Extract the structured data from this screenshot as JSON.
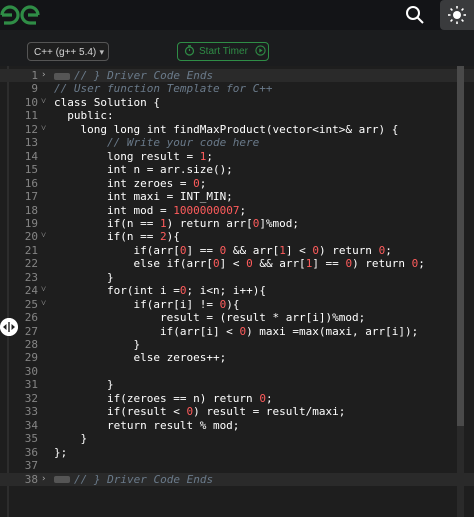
{
  "header": {
    "logo_alt": "GfG",
    "icons": {
      "search": "search-icon",
      "theme": "sun-icon"
    }
  },
  "toolbar": {
    "language": "C++ (g++ 5.4)",
    "timer_label": "Start Timer"
  },
  "editor": {
    "lines": [
      {
        "n": "1",
        "fold": "›",
        "text": "// } Driver Code Ends"
      },
      {
        "n": "9",
        "fold": "",
        "text": "// User function Template for C++"
      },
      {
        "n": "10",
        "fold": "˅",
        "text": "class Solution {"
      },
      {
        "n": "11",
        "fold": "",
        "text": "  public:"
      },
      {
        "n": "12",
        "fold": "˅",
        "text": "    long long int findMaxProduct(vector<int>& arr) {"
      },
      {
        "n": "13",
        "fold": "",
        "text": "        // Write your code here"
      },
      {
        "n": "14",
        "fold": "",
        "text": "        long result = 1;"
      },
      {
        "n": "15",
        "fold": "",
        "text": "        int n = arr.size();"
      },
      {
        "n": "16",
        "fold": "",
        "text": "        int zeroes = 0;"
      },
      {
        "n": "17",
        "fold": "",
        "text": "        int maxi = INT_MIN;"
      },
      {
        "n": "18",
        "fold": "",
        "text": "        int mod = 1000000007;"
      },
      {
        "n": "19",
        "fold": "",
        "text": "        if(n == 1) return arr[0]%mod;"
      },
      {
        "n": "20",
        "fold": "˅",
        "text": "        if(n == 2){"
      },
      {
        "n": "21",
        "fold": "",
        "text": "            if(arr[0] == 0 && arr[1] < 0) return 0;"
      },
      {
        "n": "22",
        "fold": "",
        "text": "            else if(arr[0] < 0 && arr[1] == 0) return 0;"
      },
      {
        "n": "23",
        "fold": "",
        "text": "        }"
      },
      {
        "n": "24",
        "fold": "˅",
        "text": "        for(int i =0; i<n; i++){"
      },
      {
        "n": "25",
        "fold": "˅",
        "text": "            if(arr[i] != 0){"
      },
      {
        "n": "26",
        "fold": "",
        "text": "                result = (result * arr[i])%mod;"
      },
      {
        "n": "27",
        "fold": "",
        "text": "                if(arr[i] < 0) maxi =max(maxi, arr[i]);"
      },
      {
        "n": "28",
        "fold": "",
        "text": "            }"
      },
      {
        "n": "29",
        "fold": "",
        "text": "            else zeroes++;"
      },
      {
        "n": "30",
        "fold": "",
        "text": ""
      },
      {
        "n": "31",
        "fold": "",
        "text": "        }"
      },
      {
        "n": "32",
        "fold": "",
        "text": "        if(zeroes == n) return 0;"
      },
      {
        "n": "33",
        "fold": "",
        "text": "        if(result < 0) result = result/maxi;"
      },
      {
        "n": "34",
        "fold": "",
        "text": "        return result % mod;"
      },
      {
        "n": "35",
        "fold": "",
        "text": "    }"
      },
      {
        "n": "36",
        "fold": "",
        "text": "};"
      },
      {
        "n": "37",
        "fold": "",
        "text": ""
      },
      {
        "n": "38",
        "fold": "›",
        "text": "// } Driver Code Ends"
      }
    ]
  },
  "colors": {
    "accent": "#2f8d46",
    "number": "#ff5c5c",
    "comment": "#6a7a8a"
  }
}
